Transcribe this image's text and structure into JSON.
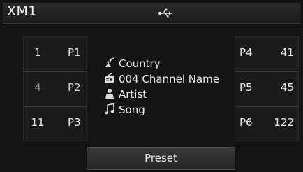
{
  "status_bar": {
    "band": "XM1",
    "usb_icon": "usb-icon"
  },
  "presets_left": [
    {
      "number": "1",
      "label": "P1",
      "active": false
    },
    {
      "number": "4",
      "label": "P2",
      "active": true
    },
    {
      "number": "11",
      "label": "P3",
      "active": false
    }
  ],
  "presets_right": [
    {
      "number": "41",
      "label": "P4",
      "active": false
    },
    {
      "number": "45",
      "label": "P5",
      "active": false
    },
    {
      "number": "122",
      "label": "P6",
      "active": false
    }
  ],
  "info": {
    "category": "Country",
    "channel": "004 Channel Name",
    "artist": "Artist",
    "song": "Song",
    "icons": [
      "satellite-icon",
      "radio-channel-icon",
      "artist-icon",
      "music-note-icon"
    ]
  },
  "buttons": {
    "preset_label": "Preset"
  },
  "colors": {
    "background": "#141414",
    "text": "#e8e8e8",
    "inactive_text": "#8a8a8a"
  }
}
